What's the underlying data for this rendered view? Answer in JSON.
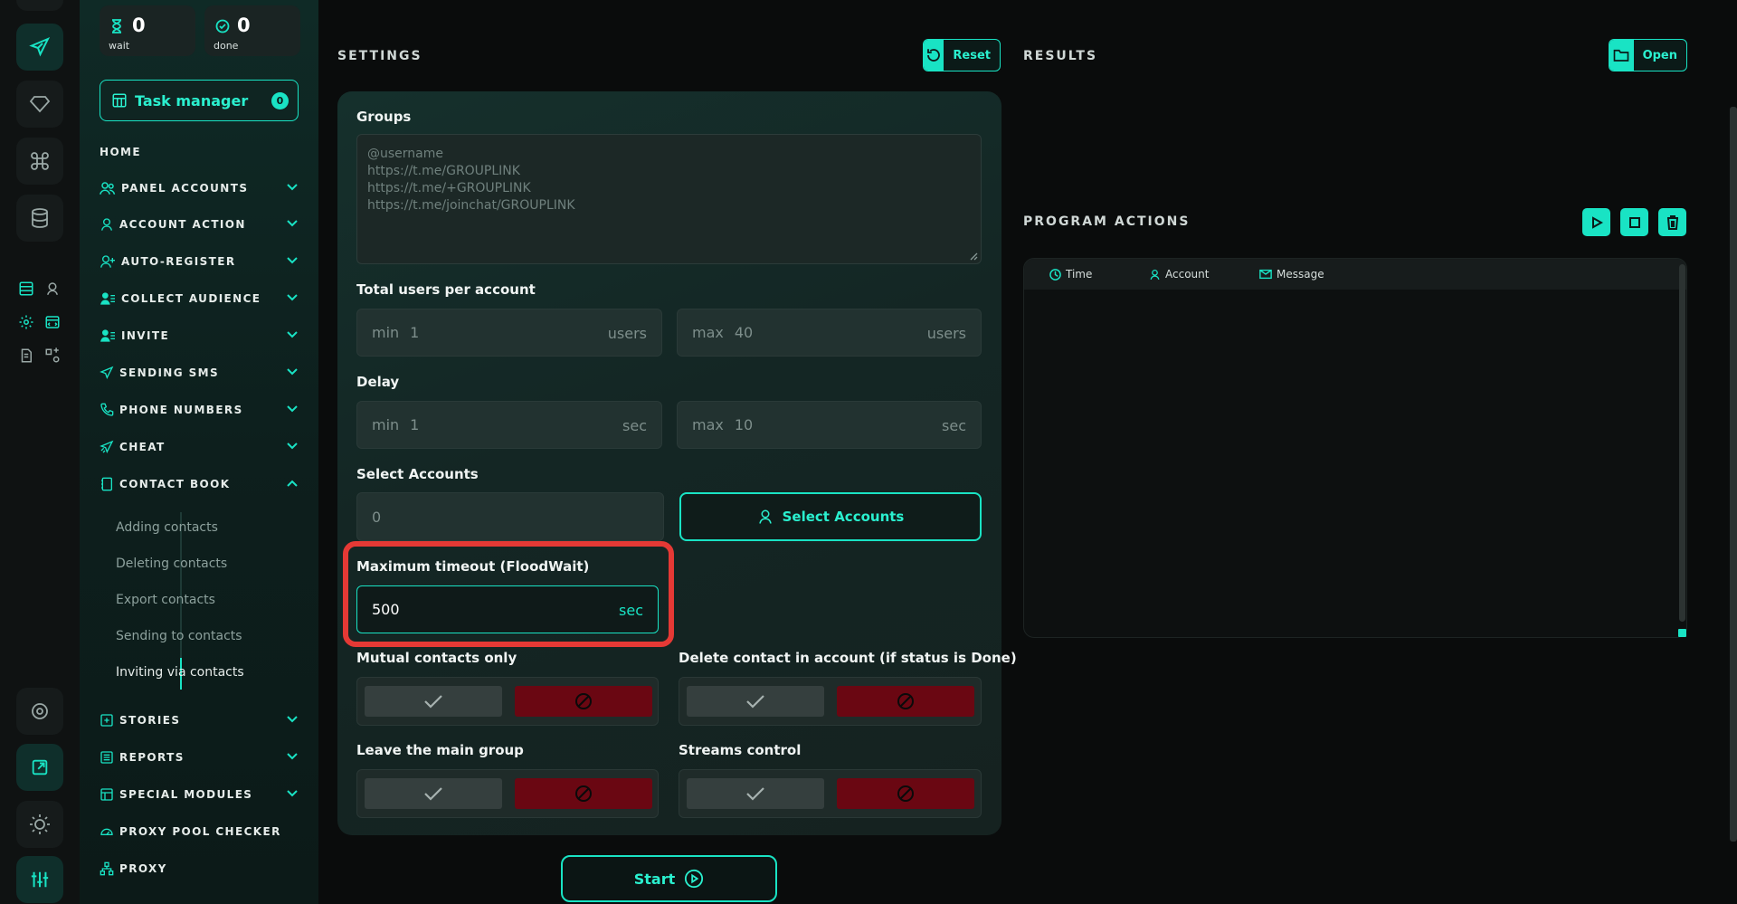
{
  "stats": {
    "wait": {
      "count": "0",
      "label": "wait",
      "icon": "hourglass-icon"
    },
    "done": {
      "count": "0",
      "label": "done",
      "icon": "check-circle-icon"
    }
  },
  "task_manager": {
    "label": "Task manager",
    "badge": "0"
  },
  "nav": {
    "home": "HOME",
    "items": [
      {
        "label": "PANEL ACCOUNTS",
        "icon": "users-icon"
      },
      {
        "label": "ACCOUNT ACTION",
        "icon": "user-icon"
      },
      {
        "label": "AUTO-REGISTER",
        "icon": "user-plus-icon"
      },
      {
        "label": "COLLECT AUDIENCE",
        "icon": "user-list-icon"
      },
      {
        "label": "INVITE",
        "icon": "user-list-icon"
      },
      {
        "label": "SENDING SMS",
        "icon": "send-icon"
      },
      {
        "label": "PHONE NUMBERS",
        "icon": "phone-icon"
      },
      {
        "label": "CHEAT",
        "icon": "send-icon"
      },
      {
        "label": "CONTACT BOOK",
        "icon": "book-icon"
      }
    ],
    "contact_book_sub": [
      "Adding contacts",
      "Deleting contacts",
      "Export contacts",
      "Sending to contacts",
      "Inviting via contacts"
    ],
    "items_after": [
      {
        "label": "STORIES",
        "icon": "plus-square-icon"
      },
      {
        "label": "REPORTS",
        "icon": "list-icon"
      },
      {
        "label": "SPECIAL MODULES",
        "icon": "grid-icon"
      },
      {
        "label": "PROXY POOL CHECKER",
        "icon": "gauge-icon"
      },
      {
        "label": "PROXY",
        "icon": "network-icon"
      }
    ]
  },
  "settings": {
    "title": "SETTINGS",
    "reset_label": "Reset",
    "groups_label": "Groups",
    "groups_placeholder": "@username\nhttps://t.me/GROUPLINK\nhttps://t.me/+GROUPLINK\nhttps://t.me/joinchat/GROUPLINK",
    "total_users_label": "Total users per account",
    "users_min": {
      "prefix": "min",
      "value": "1",
      "suffix": "users"
    },
    "users_max": {
      "prefix": "max",
      "value": "40",
      "suffix": "users"
    },
    "delay_label": "Delay",
    "delay_min": {
      "prefix": "min",
      "value": "1",
      "suffix": "sec"
    },
    "delay_max": {
      "prefix": "max",
      "value": "10",
      "suffix": "sec"
    },
    "select_accounts_label": "Select Accounts",
    "select_accounts_value": "0",
    "select_accounts_button": "Select Accounts",
    "floodwait_label": "Maximum timeout (FloodWait)",
    "floodwait_value": "500",
    "floodwait_suffix": "sec",
    "mutual_label": "Mutual contacts only",
    "delete_label": "Delete contact in account (if status is Done)",
    "leave_label": "Leave the main group",
    "streams_label": "Streams control",
    "start_label": "Start"
  },
  "results": {
    "title": "RESULTS",
    "open_label": "Open"
  },
  "program_actions": {
    "title": "PROGRAM ACTIONS",
    "columns": [
      {
        "label": "Time",
        "icon": "clock-icon"
      },
      {
        "label": "Account",
        "icon": "user-icon"
      },
      {
        "label": "Message",
        "icon": "mail-icon"
      }
    ]
  },
  "colors": {
    "accent": "#19e3c4",
    "danger": "#6a0712",
    "highlight": "#e53935"
  }
}
